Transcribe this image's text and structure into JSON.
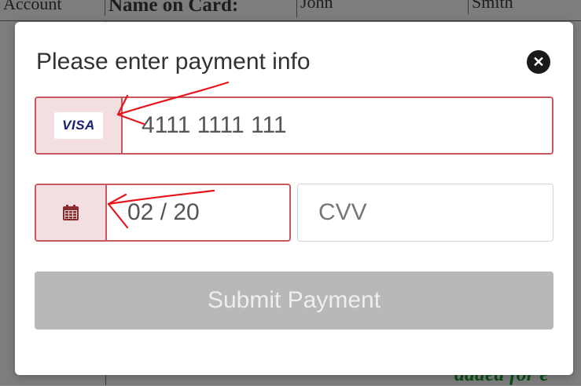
{
  "background": {
    "cells": [
      "Account",
      "Name on Card:",
      "John",
      "Smith"
    ],
    "footer_text": "added for e"
  },
  "modal": {
    "title": "Please enter payment info",
    "close_icon": "close-icon",
    "card": {
      "brand_label": "VISA",
      "number_value": "4111 1111 111"
    },
    "expiry": {
      "icon": "calendar-icon",
      "value": "02 / 20"
    },
    "cvv": {
      "placeholder": "CVV"
    },
    "submit_label": "Submit Payment"
  },
  "colors": {
    "error_border": "#c8585e",
    "error_addon_bg": "#f3dfe0",
    "annotation": "#e8141c",
    "disabled_button": "#b8b8b8"
  }
}
